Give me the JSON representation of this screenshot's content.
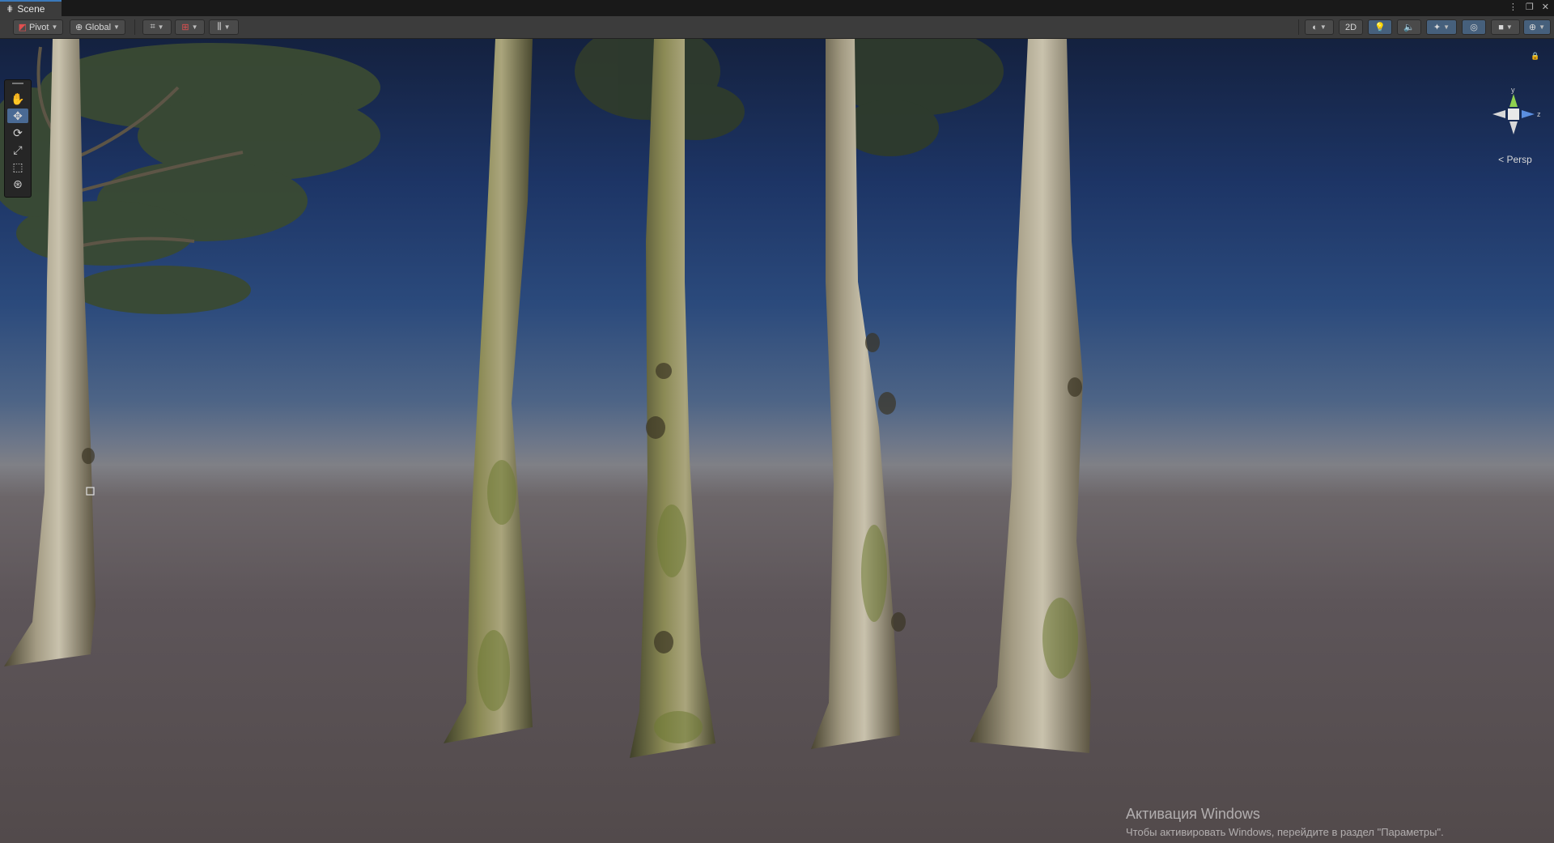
{
  "window": {
    "tab_label": "Scene",
    "tab_icon": "grid-icon"
  },
  "toolbar": {
    "pivot_label": "Pivot",
    "global_label": "Global",
    "mode_2d_label": "2D"
  },
  "scene": {
    "camera_mode": "Persp",
    "axis_y": "y",
    "axis_z": "z"
  },
  "tools": [
    "hand-tool",
    "move-tool",
    "rotate-tool",
    "scale-tool",
    "rect-tool",
    "transform-tool"
  ],
  "watermark": {
    "title": "Активация Windows",
    "subtitle": "Чтобы активировать Windows, перейдите в раздел \"Параметры\"."
  },
  "colors": {
    "sky_top": "#14213f",
    "horizon": "#7f8086",
    "ground": "#524a4b",
    "tab_accent": "#3a79bb",
    "active_tool": "#4a6a94",
    "gizmo_y": "#8fd14f",
    "gizmo_z": "#5b8fe0"
  }
}
